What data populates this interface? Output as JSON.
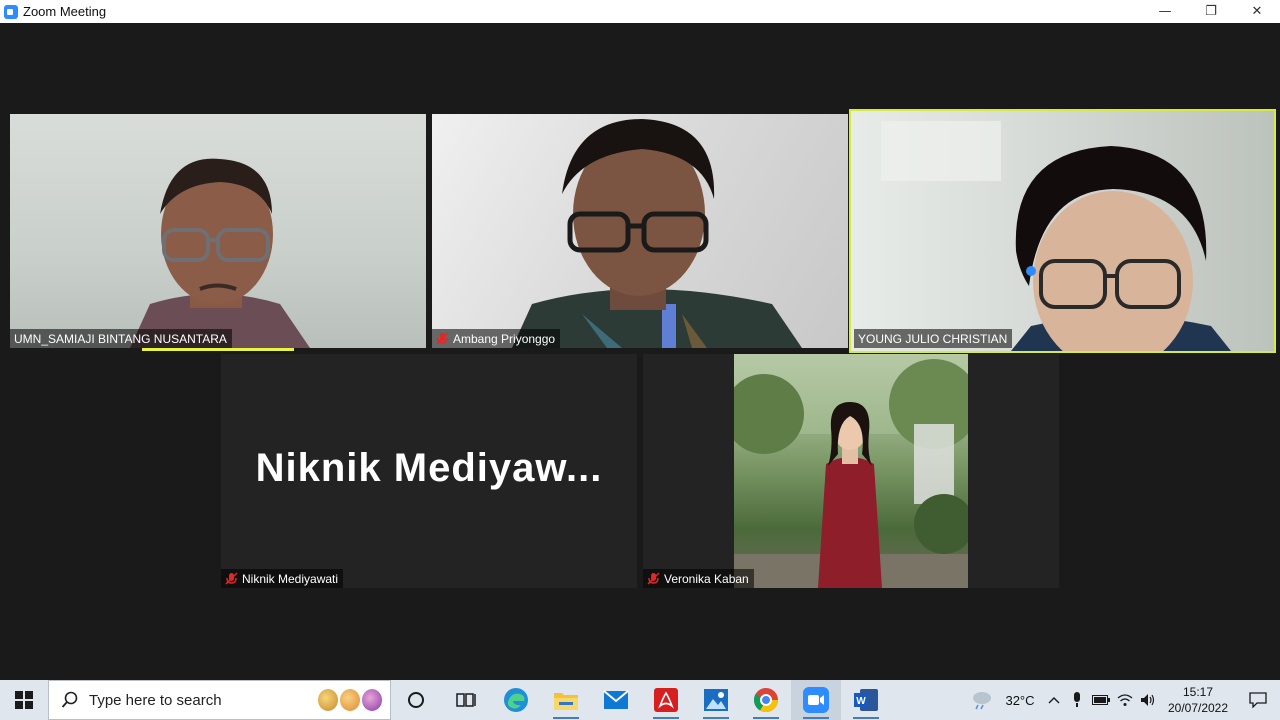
{
  "window": {
    "title": "Zoom Meeting",
    "minimize_glyph": "—",
    "restore_glyph": "❐",
    "close_glyph": "✕"
  },
  "participants": [
    {
      "name": "UMN_SAMIAJI BINTANG NUSANTARA",
      "muted": false,
      "speaking": true,
      "active_speaker": false
    },
    {
      "name": "Ambang Priyonggo",
      "muted": true,
      "speaking": false,
      "active_speaker": false
    },
    {
      "name": "YOUNG JULIO CHRISTIAN",
      "muted": false,
      "speaking": false,
      "active_speaker": true
    },
    {
      "name": "Niknik Mediyawati",
      "display_name_large": "Niknik  Mediyaw...",
      "muted": true,
      "video": false
    },
    {
      "name": "Veronika Kaban",
      "muted": true,
      "video": true
    }
  ],
  "colors": {
    "stage_bg": "#1a1a1a",
    "active_speaker_border": "#d5ec3f",
    "mic_muted": "#e02828"
  },
  "taskbar": {
    "search_placeholder": "Type here to search",
    "apps": [
      "task-view",
      "edge",
      "file-explorer",
      "mail",
      "acrobat",
      "photos",
      "chrome",
      "zoom",
      "word"
    ],
    "weather_temp": "32°C",
    "time": "15:17",
    "date": "20/07/2022"
  }
}
